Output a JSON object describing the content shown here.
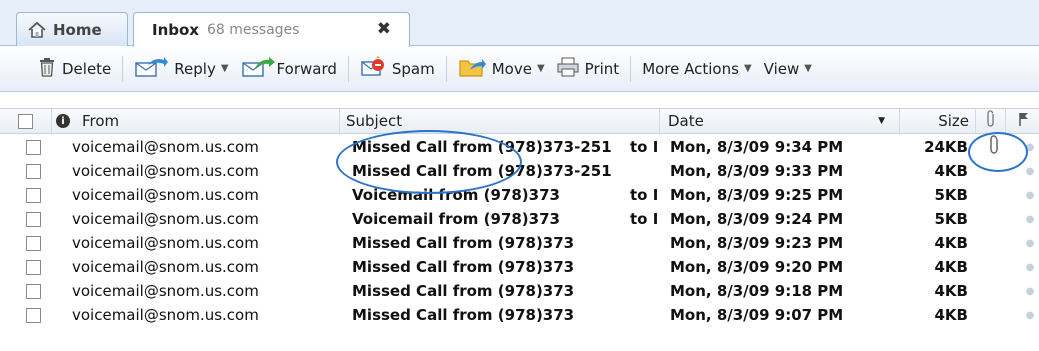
{
  "tabs": [
    {
      "label": "Home"
    },
    {
      "label": "Inbox",
      "count": "68 messages"
    }
  ],
  "tab_close": "✖",
  "toolbar": {
    "delete": "Delete",
    "reply": "Reply",
    "forward": "Forward",
    "spam": "Spam",
    "move": "Move",
    "print": "Print",
    "more_actions": "More Actions",
    "view": "View"
  },
  "columns": {
    "from": "From",
    "subject": "Subject",
    "date": "Date",
    "size": "Size"
  },
  "messages": [
    {
      "from": "voicemail@snom.us.com",
      "subject": "Missed Call from (978)373-251",
      "to": "to I",
      "date": "Mon, 8/3/09 9:34 PM",
      "size": "24KB",
      "attachment": true
    },
    {
      "from": "voicemail@snom.us.com",
      "subject": "Missed Call from (978)373-251",
      "to": "",
      "date": "Mon, 8/3/09 9:33 PM",
      "size": "4KB",
      "attachment": false
    },
    {
      "from": "voicemail@snom.us.com",
      "subject": "Voicemail from (978)373",
      "to": "to I",
      "date": "Mon, 8/3/09 9:25 PM",
      "size": "5KB",
      "attachment": false
    },
    {
      "from": "voicemail@snom.us.com",
      "subject": "Voicemail from (978)373",
      "to": "to I",
      "date": "Mon, 8/3/09 9:24 PM",
      "size": "5KB",
      "attachment": false
    },
    {
      "from": "voicemail@snom.us.com",
      "subject": "Missed Call from (978)373",
      "to": "",
      "date": "Mon, 8/3/09 9:23 PM",
      "size": "4KB",
      "attachment": false
    },
    {
      "from": "voicemail@snom.us.com",
      "subject": "Missed Call from (978)373",
      "to": "",
      "date": "Mon, 8/3/09 9:20 PM",
      "size": "4KB",
      "attachment": false
    },
    {
      "from": "voicemail@snom.us.com",
      "subject": "Missed Call from (978)373",
      "to": "",
      "date": "Mon, 8/3/09 9:18 PM",
      "size": "4KB",
      "attachment": false
    },
    {
      "from": "voicemail@snom.us.com",
      "subject": "Missed Call from (978)373",
      "to": "",
      "date": "Mon, 8/3/09 9:07 PM",
      "size": "4KB",
      "attachment": false
    }
  ],
  "colors": {
    "accent": "#2b73c9",
    "tabbar_bg": "#e6eef9",
    "row_flag": "#c8d0dc"
  }
}
